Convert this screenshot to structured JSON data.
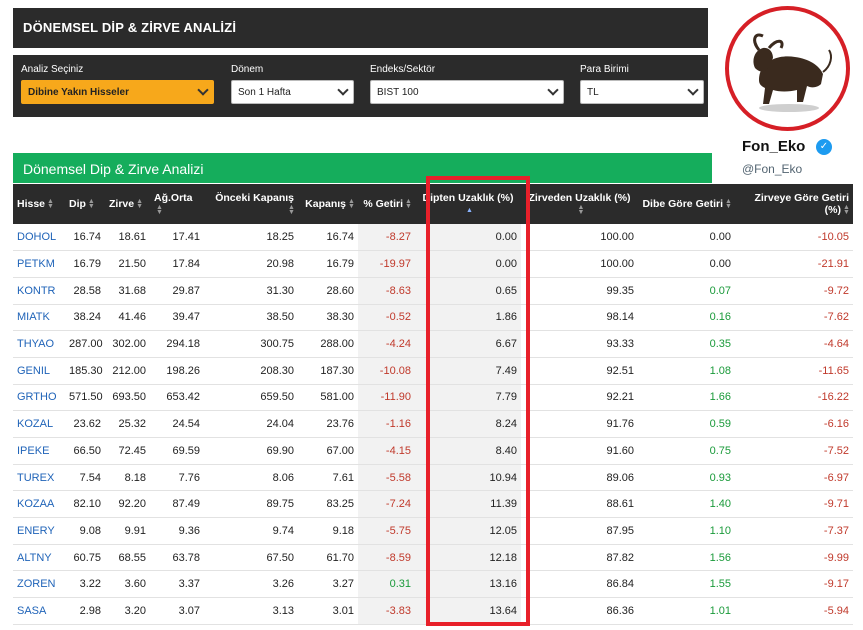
{
  "top_panel": {
    "title": "DÖNEMSEL DİP & ZİRVE ANALİZİ"
  },
  "filters": {
    "analysis_label": "Analiz Seçiniz",
    "analysis_value": "Dibine Yakın Hisseler",
    "period_label": "Dönem",
    "period_value": "Son 1 Hafta",
    "index_label": "Endeks/Sektör",
    "index_value": "BIST 100",
    "currency_label": "Para Birimi",
    "currency_value": "TL"
  },
  "table_title": "Dönemsel Dip & Zirve Analizi",
  "columns": [
    "Hisse",
    "Dip",
    "Zirve",
    "Ağ.Orta",
    "Önceki Kapanış",
    "Kapanış",
    "% Getiri",
    "Dipten Uzaklık (%)",
    "Zirveden Uzaklık (%)",
    "Dibe Göre Getiri",
    "Zirveye Göre Getiri (%)"
  ],
  "rows": [
    [
      "DOHOL",
      "16.74",
      "18.61",
      "17.41",
      "18.25",
      "16.74",
      "-8.27",
      "0.00",
      "100.00",
      "0.00",
      "-10.05"
    ],
    [
      "PETKM",
      "16.79",
      "21.50",
      "17.84",
      "20.98",
      "16.79",
      "-19.97",
      "0.00",
      "100.00",
      "0.00",
      "-21.91"
    ],
    [
      "KONTR",
      "28.58",
      "31.68",
      "29.87",
      "31.30",
      "28.60",
      "-8.63",
      "0.65",
      "99.35",
      "0.07",
      "-9.72"
    ],
    [
      "MIATK",
      "38.24",
      "41.46",
      "39.47",
      "38.50",
      "38.30",
      "-0.52",
      "1.86",
      "98.14",
      "0.16",
      "-7.62"
    ],
    [
      "THYAO",
      "287.00",
      "302.00",
      "294.18",
      "300.75",
      "288.00",
      "-4.24",
      "6.67",
      "93.33",
      "0.35",
      "-4.64"
    ],
    [
      "GENIL",
      "185.30",
      "212.00",
      "198.26",
      "208.30",
      "187.30",
      "-10.08",
      "7.49",
      "92.51",
      "1.08",
      "-11.65"
    ],
    [
      "GRTHO",
      "571.50",
      "693.50",
      "653.42",
      "659.50",
      "581.00",
      "-11.90",
      "7.79",
      "92.21",
      "1.66",
      "-16.22"
    ],
    [
      "KOZAL",
      "23.62",
      "25.32",
      "24.54",
      "24.04",
      "23.76",
      "-1.16",
      "8.24",
      "91.76",
      "0.59",
      "-6.16"
    ],
    [
      "IPEKE",
      "66.50",
      "72.45",
      "69.59",
      "69.90",
      "67.00",
      "-4.15",
      "8.40",
      "91.60",
      "0.75",
      "-7.52"
    ],
    [
      "TUREX",
      "7.54",
      "8.18",
      "7.76",
      "8.06",
      "7.61",
      "-5.58",
      "10.94",
      "89.06",
      "0.93",
      "-6.97"
    ],
    [
      "KOZAA",
      "82.10",
      "92.20",
      "87.49",
      "89.75",
      "83.25",
      "-7.24",
      "11.39",
      "88.61",
      "1.40",
      "-9.71"
    ],
    [
      "ENERY",
      "9.08",
      "9.91",
      "9.36",
      "9.74",
      "9.18",
      "-5.75",
      "12.05",
      "87.95",
      "1.10",
      "-7.37"
    ],
    [
      "ALTNY",
      "60.75",
      "68.55",
      "63.78",
      "67.50",
      "61.70",
      "-8.59",
      "12.18",
      "87.82",
      "1.56",
      "-9.99"
    ],
    [
      "ZOREN",
      "3.22",
      "3.60",
      "3.37",
      "3.26",
      "3.27",
      "0.31",
      "13.16",
      "86.84",
      "1.55",
      "-9.17"
    ],
    [
      "SASA",
      "2.98",
      "3.20",
      "3.07",
      "3.13",
      "3.01",
      "-3.83",
      "13.64",
      "86.36",
      "1.01",
      "-5.94"
    ]
  ],
  "profile": {
    "name": "Fon_Eko",
    "handle": "@Fon_Eko"
  },
  "colors": {
    "accent_green": "#15ad5c",
    "highlight_red": "#e8202a",
    "negative": "#c0392b",
    "positive": "#1a9a3a",
    "dark_panel": "#2b2b2b",
    "dropdown_orange": "#f7a81b"
  }
}
